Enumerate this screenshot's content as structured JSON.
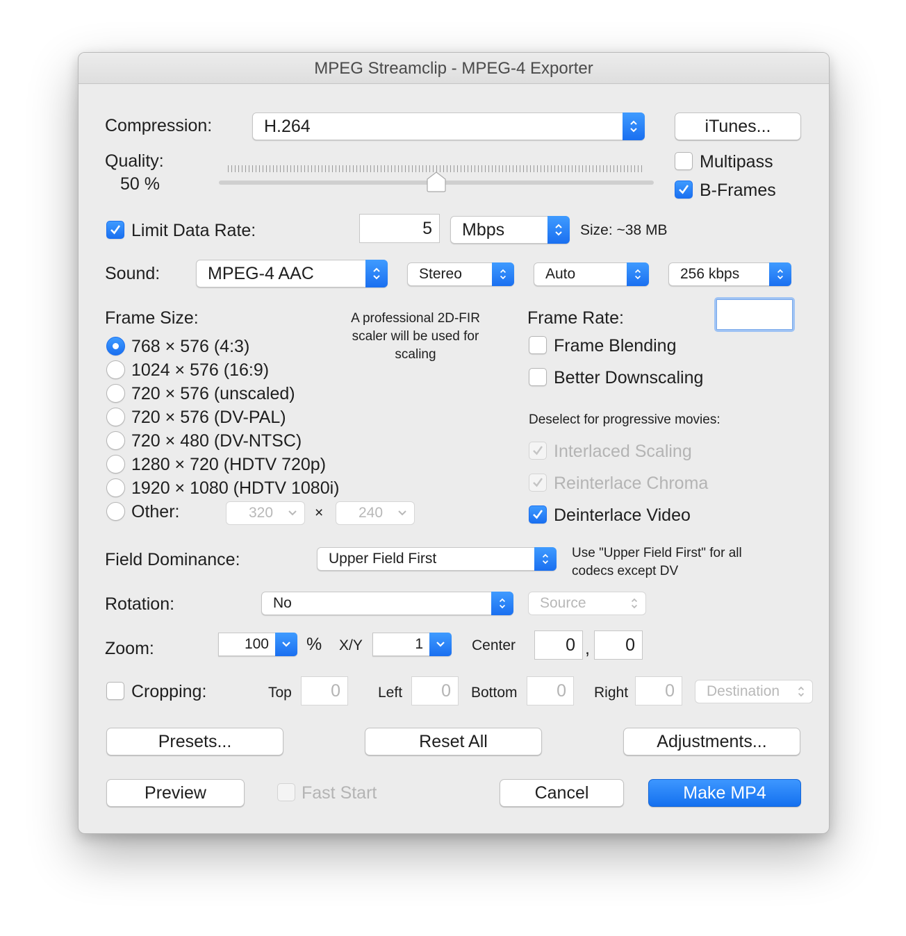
{
  "window": {
    "title": "MPEG Streamclip - MPEG-4 Exporter"
  },
  "compression": {
    "label": "Compression:",
    "value": "H.264",
    "itunes_button": "iTunes..."
  },
  "quality": {
    "label": "Quality:",
    "value": "50 %",
    "slider_fraction": 0.5
  },
  "multipass": {
    "label": "Multipass",
    "checked": false
  },
  "bframes": {
    "label": "B-Frames",
    "checked": true
  },
  "data_rate": {
    "label": "Limit Data Rate:",
    "checked": true,
    "value": "5",
    "unit": "Mbps",
    "size": "Size: ~38 MB"
  },
  "sound": {
    "label": "Sound:",
    "codec": "MPEG-4 AAC",
    "channels": "Stereo",
    "rate": "Auto",
    "bitrate": "256 kbps"
  },
  "frame_size": {
    "label": "Frame Size:",
    "note": "A professional 2D-FIR scaler will be used for scaling",
    "options": [
      "768 × 576  (4:3)",
      "1024 × 576  (16:9)",
      "720 × 576  (unscaled)",
      "720 × 576  (DV-PAL)",
      "720 × 480  (DV-NTSC)",
      "1280 × 720  (HDTV 720p)",
      "1920 × 1080  (HDTV 1080i)"
    ],
    "selected_index": 0,
    "other_label": "Other:",
    "other_width": "320",
    "times": "×",
    "other_height": "240"
  },
  "frame_rate": {
    "label": "Frame Rate:",
    "value": "",
    "frame_blending": "Frame Blending",
    "better_downscaling": "Better Downscaling",
    "deselect_note": "Deselect for progressive movies:",
    "interlaced_scaling": "Interlaced Scaling",
    "reinterlace_chroma": "Reinterlace Chroma",
    "deinterlace_video": "Deinterlace Video"
  },
  "field_dominance": {
    "label": "Field Dominance:",
    "value": "Upper Field First",
    "note": "Use \"Upper Field First\" for all codecs except DV"
  },
  "rotation": {
    "label": "Rotation:",
    "value": "No",
    "source": "Source"
  },
  "zoom": {
    "label": "Zoom:",
    "value": "100",
    "percent": "%",
    "xy_label": "X/Y",
    "xy_value": "1",
    "center_label": "Center",
    "center_x": "0",
    "comma": ",",
    "center_y": "0"
  },
  "cropping": {
    "label": "Cropping:",
    "checked": false,
    "top_label": "Top",
    "top": "0",
    "left_label": "Left",
    "left": "0",
    "bottom_label": "Bottom",
    "bottom": "0",
    "right_label": "Right",
    "right": "0",
    "destination": "Destination"
  },
  "buttons": {
    "presets": "Presets...",
    "reset_all": "Reset All",
    "adjustments": "Adjustments...",
    "preview": "Preview",
    "fast_start": "Fast Start",
    "cancel": "Cancel",
    "make": "Make MP4"
  },
  "colors": {
    "accent": "#1a6ff0",
    "window_bg": "#ececec"
  }
}
